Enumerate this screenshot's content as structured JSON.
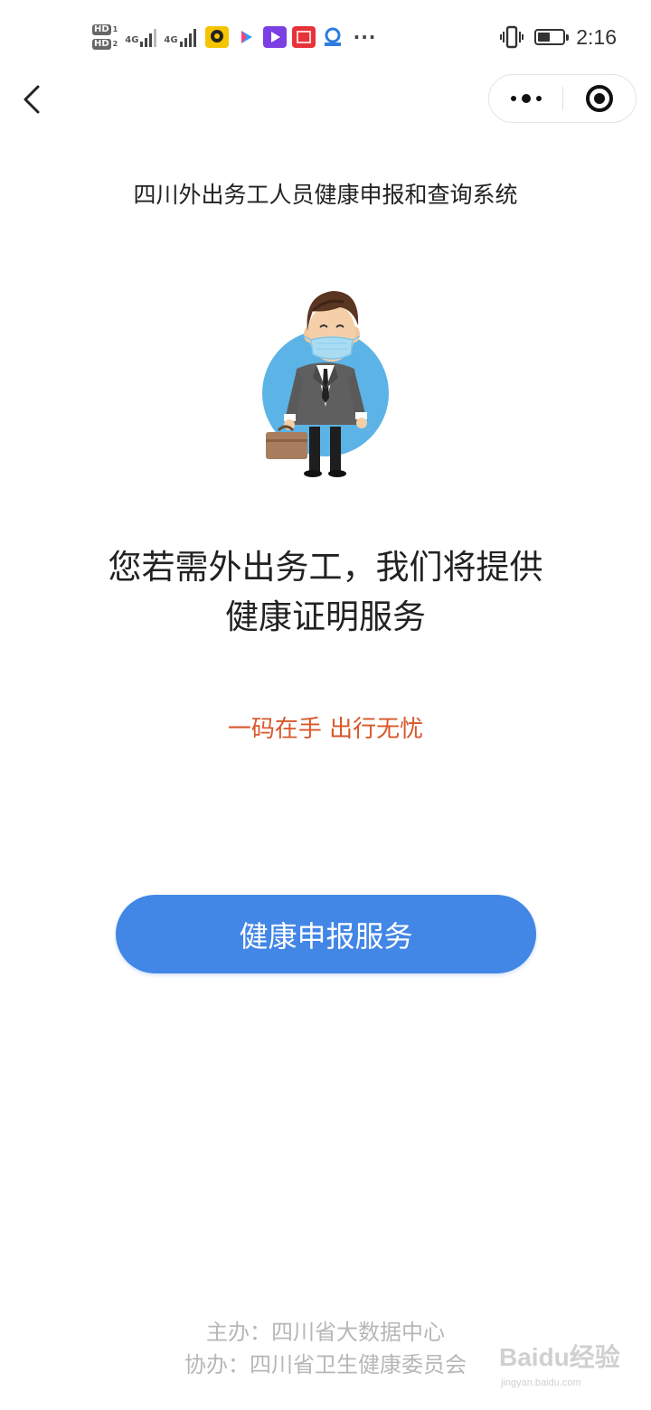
{
  "status_bar": {
    "sim1": "HD",
    "sim1_index": "1",
    "sim2": "HD",
    "sim2_index": "2",
    "network1": "4G",
    "network2": "4G",
    "app_icons": [
      "app-icon-yellow",
      "app-icon-pink",
      "app-icon-purple",
      "app-icon-red",
      "app-icon-blue"
    ],
    "overflow": "···",
    "battery_level": 0.5,
    "time": "2:16"
  },
  "nav": {
    "back_icon": "chevron-left-icon",
    "more_icon": "more-dots-icon",
    "close_icon": "target-close-icon"
  },
  "page": {
    "system_title": "四川外出务工人员健康申报和查询系统",
    "headline_line1": "您若需外出务工，我们将提供",
    "headline_line2": "健康证明服务",
    "slogan": "一码在手 出行无忧",
    "primary_button": "健康申报服务"
  },
  "footer": {
    "host": "主办：四川省大数据中心",
    "co_host": "协办：四川省卫生健康委员会"
  },
  "watermark": {
    "name": "Baidu经验",
    "url": "jingyan.baidu.com"
  },
  "colors": {
    "accent": "#4286e6",
    "slogan": "#d9572a",
    "footer_text": "#b7b7b7",
    "illustration_circle": "#5bb3e6"
  }
}
